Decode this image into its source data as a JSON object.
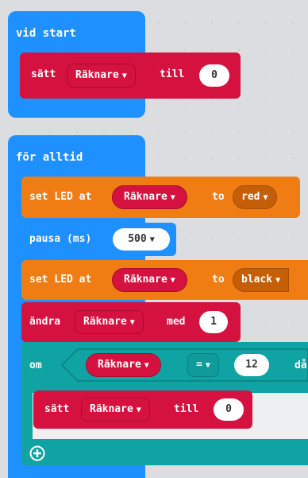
{
  "on_start": {
    "label": "vid start",
    "set_block": {
      "label": "sätt",
      "variable": "Räknare",
      "to_label": "till",
      "value": "0"
    }
  },
  "forever": {
    "label": "för alltid",
    "set_led_1": {
      "label": "set LED at",
      "variable": "Räknare",
      "to_label": "to",
      "color": "red"
    },
    "pause": {
      "label": "pausa (ms)",
      "value": "500"
    },
    "set_led_2": {
      "label": "set LED at",
      "variable": "Räknare",
      "to_label": "to",
      "color": "black"
    },
    "change": {
      "label": "ändra",
      "variable": "Räknare",
      "by_label": "med",
      "value": "1"
    },
    "if_block": {
      "label": "om",
      "variable": "Räknare",
      "operator": "=",
      "compare_value": "12",
      "then_label": "då",
      "inner_set": {
        "label": "sätt",
        "variable": "Räknare",
        "to_label": "till",
        "value": "0"
      }
    }
  },
  "colors": {
    "blue": "#1e90ff",
    "red": "#d5123f",
    "orange": "#f07d13",
    "teal": "#0fa3a3",
    "background": "#eeeff1"
  },
  "icons": {
    "add": "plus-circle-icon",
    "caret": "caret-down-icon"
  }
}
